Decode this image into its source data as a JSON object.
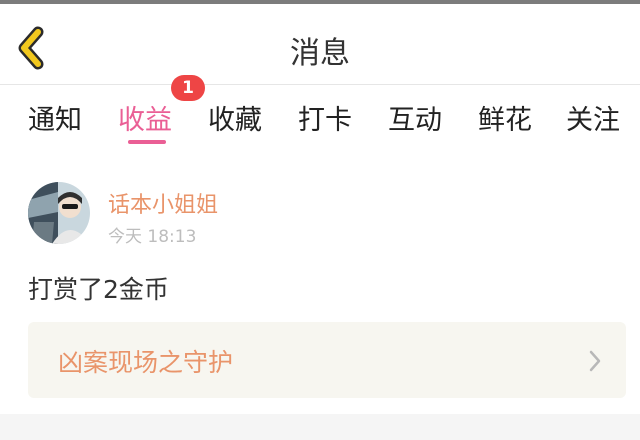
{
  "header": {
    "title": "消息"
  },
  "tabs": [
    {
      "label": "通知"
    },
    {
      "label": "收益"
    },
    {
      "label": "收藏"
    },
    {
      "label": "打卡"
    },
    {
      "label": "互动"
    },
    {
      "label": "鲜花"
    },
    {
      "label": "关注"
    }
  ],
  "active_tab": "收益",
  "badge": {
    "count": "1"
  },
  "message": {
    "sender": "话本小姐姐",
    "time": "今天 18:13",
    "text": "打赏了2金币",
    "link_title": "凶案现场之守护"
  },
  "colors": {
    "accent_pink": "#ea5f95",
    "sender_orange": "#e9946a",
    "badge_red": "#ee4545",
    "back_yellow": "#f2c81e"
  },
  "icons": [
    "back-arrow-icon",
    "chevron-right-icon"
  ]
}
